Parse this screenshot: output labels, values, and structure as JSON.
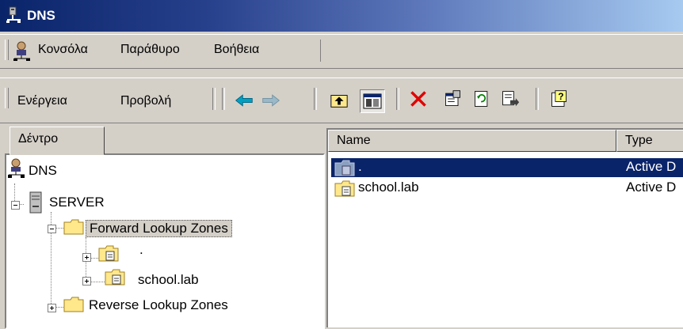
{
  "window": {
    "title": "DNS"
  },
  "menu": {
    "items": [
      "Κονσόλα",
      "Παράθυρο",
      "Βοήθεια"
    ]
  },
  "toolbar": {
    "action_label": "Ενέργεια",
    "view_label": "Προβολή"
  },
  "tree": {
    "tab_label": "Δέντρο",
    "nodes": {
      "root": "DNS",
      "server": "SERVER",
      "forward": "Forward Lookup Zones",
      "dot_zone": ".",
      "school": "school.lab",
      "reverse": "Reverse Lookup Zones"
    }
  },
  "list": {
    "columns": [
      "Name",
      "Type"
    ],
    "rows": [
      {
        "name": ".",
        "type": "Active D"
      },
      {
        "name": "school.lab",
        "type": "Active D"
      }
    ]
  },
  "colors": {
    "selection": "#0a246a",
    "face": "#d4d0c8",
    "title_start": "#0a246a"
  }
}
